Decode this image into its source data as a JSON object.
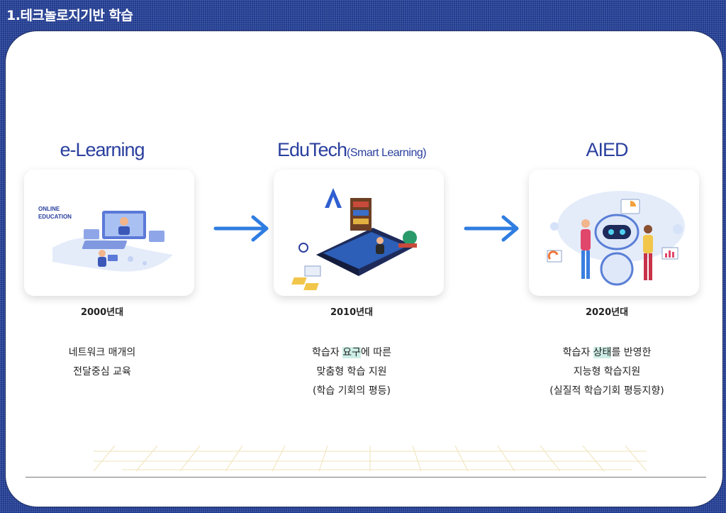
{
  "header": {
    "title": "1.테크놀로지기반 학습"
  },
  "stages": [
    {
      "heading": "e-Learning",
      "heading_sub": "",
      "card_label_line1": "ONLINE",
      "card_label_line2": "EDUCATION",
      "era": "2000년대",
      "desc_line1": "네트워크 매개의",
      "desc_line2": "전달중심 교육"
    },
    {
      "heading": "EduTech",
      "heading_sub": "(Smart Learning)",
      "era": "2010년대",
      "desc_line1_pre": "학습자 ",
      "desc_line1_hl": "요구",
      "desc_line1_post": "에 따른",
      "desc_line2": "맞춤형 학습 지원",
      "desc_line3": "(학습 기회의 평등)"
    },
    {
      "heading": "AIED",
      "heading_sub": "",
      "era": "2020년대",
      "desc_line1_pre": "학습자 ",
      "desc_line1_hl": "상태",
      "desc_line1_post": "를 반영한",
      "desc_line2": "지능형 학습지원",
      "desc_line3": "(실질적 학습기회 평등지향)"
    }
  ],
  "colors": {
    "header_bg": "#1f3a8f",
    "heading": "#2a3f9e",
    "arrow": "#2f7de1",
    "highlight": "#cdeee6"
  },
  "icons": [
    "arrow-right-icon",
    "arrow-right-icon"
  ]
}
